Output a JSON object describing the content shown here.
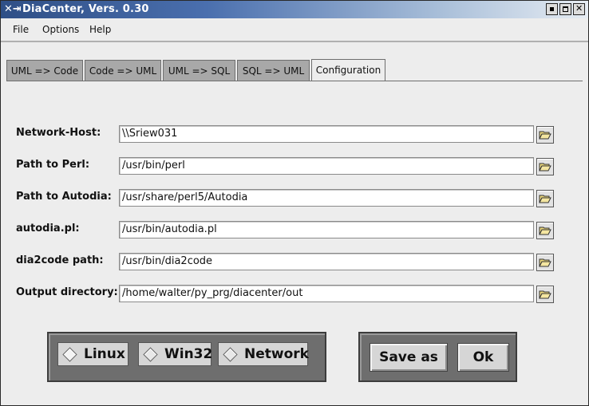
{
  "window": {
    "title": "DiaCenter, Vers. 0.30"
  },
  "menu": [
    "File",
    "Options",
    "Help"
  ],
  "tabs": [
    "UML => Code",
    "Code => UML",
    "UML => SQL",
    "SQL => UML",
    "Configuration"
  ],
  "active_tab": "Configuration",
  "config_rows": [
    {
      "label": "Network-Host:",
      "value": "\\\\Sriew031"
    },
    {
      "label": "Path to Perl:",
      "value": "/usr/bin/perl"
    },
    {
      "label": "Path to Autodia:",
      "value": "/usr/share/perl5/Autodia"
    },
    {
      "label": "autodia.pl:",
      "value": "/usr/bin/autodia.pl"
    },
    {
      "label": "dia2code path:",
      "value": "/usr/bin/dia2code"
    },
    {
      "label": "Output directory:",
      "value": "/home/walter/py_prg/diacenter/out"
    }
  ],
  "platform_options": [
    "Linux",
    "Win32",
    "Network"
  ],
  "actions": {
    "save_as": "Save as",
    "ok": "Ok"
  },
  "colors": {
    "titlebar_start": "#2f4f86",
    "titlebar_end": "#e6ecf3",
    "background": "#ededed",
    "group_background": "#6e6e6e"
  },
  "icons": {
    "browse": "open-folder-icon",
    "app": "app-logo-icon"
  }
}
